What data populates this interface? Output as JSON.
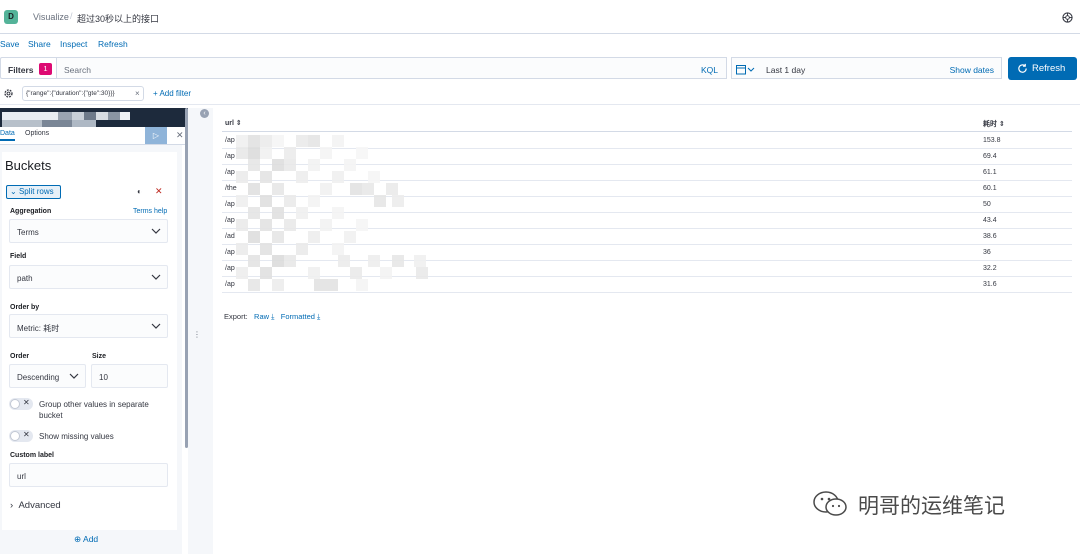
{
  "header": {
    "app_badge": "D",
    "crumb_app": "Visualize",
    "crumb_separator": "/",
    "crumb_title": "超过30秒以上的接口"
  },
  "menu": [
    "Save",
    "Share",
    "Inspect",
    "Refresh"
  ],
  "query": {
    "filters_label": "Filters",
    "filters_count": "1",
    "search_placeholder": "Search",
    "language": "KQL",
    "date_range": "Last 1 day",
    "show_dates": "Show dates",
    "refresh_label": "Refresh"
  },
  "filter_bar": {
    "pill": "{\"range\":{\"duration\":{\"gte\":30}}}",
    "add_filter": "+ Add filter"
  },
  "sidebar": {
    "tabs": [
      "Data",
      "Options"
    ],
    "buckets_title": "Buckets",
    "split_rows": "Split rows",
    "aggregation_label": "Aggregation",
    "terms_help": "Terms help",
    "aggregation_value": "Terms",
    "field_label": "Field",
    "field_value": "path",
    "order_by_label": "Order by",
    "order_by_value": "Metric: 耗时",
    "order_label": "Order",
    "order_value": "Descending",
    "size_label": "Size",
    "size_value": "10",
    "group_other": "Group other values in separate bucket",
    "show_missing": "Show missing values",
    "custom_label_label": "Custom label",
    "custom_label_value": "url",
    "advanced": "Advanced",
    "add": "Add"
  },
  "table": {
    "columns": [
      "url ⇕",
      "耗时 ⇕"
    ],
    "rows": [
      {
        "url": "/ap",
        "value": "153.8"
      },
      {
        "url": "/ap",
        "value": "69.4"
      },
      {
        "url": "/ap",
        "value": "61.1"
      },
      {
        "url": "/the",
        "value": "60.1"
      },
      {
        "url": "/ap",
        "value": "50"
      },
      {
        "url": "/ap",
        "value": "43.4"
      },
      {
        "url": "/ad",
        "value": "38.6"
      },
      {
        "url": "/ap",
        "value": "36"
      },
      {
        "url": "/ap",
        "value": "32.2"
      },
      {
        "url": "/ap",
        "value": "31.6"
      }
    ]
  },
  "export": {
    "label": "Export:",
    "raw": "Raw",
    "formatted": "Formatted"
  },
  "watermark": "明哥的运维笔记",
  "colors": {
    "accent": "#006bb4",
    "badge": "#dd0a73",
    "logo": "#54b399"
  }
}
